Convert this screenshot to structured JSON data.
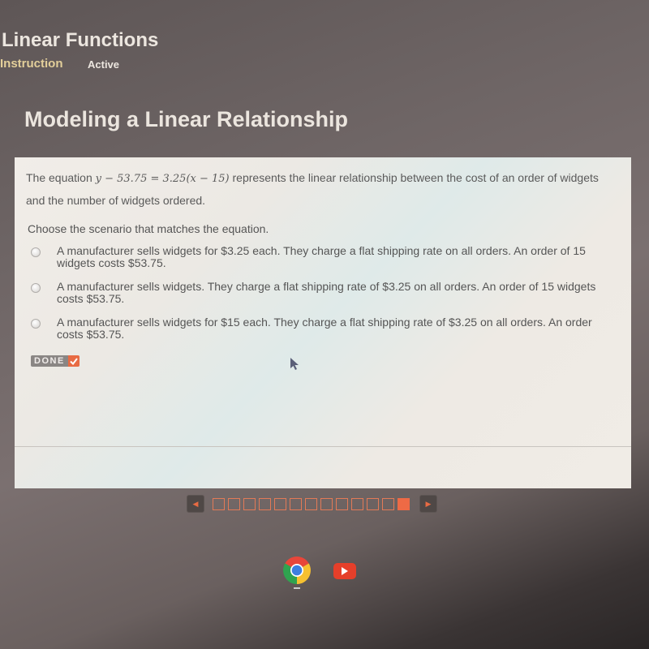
{
  "header": {
    "title": "Linear Functions",
    "tabs": [
      {
        "label": "Instruction"
      },
      {
        "label": "Active"
      }
    ]
  },
  "lesson": {
    "title": "Modeling a Linear Relationship"
  },
  "question": {
    "prompt_prefix": "The equation ",
    "equation": "y − 53.75 = 3.25(x − 15)",
    "prompt_suffix": " represents the linear relationship between the cost of an order of widgets and the number of widgets ordered.",
    "instruction": "Choose the scenario that matches the equation.",
    "options": [
      {
        "text": "A manufacturer sells widgets for $3.25 each. They charge a flat shipping rate on all orders. An order of 15 widgets costs $53.75.",
        "selected": false
      },
      {
        "text": "A manufacturer sells widgets. They charge a flat shipping rate of $3.25 on all orders. An order of 15 widgets costs $53.75.",
        "selected": false
      },
      {
        "text": "A manufacturer sells widgets for $15 each. They charge a flat shipping rate of $3.25 on all orders. An order costs $53.75.",
        "selected": false
      }
    ],
    "done_label": "DONE"
  },
  "pager": {
    "total_pages": 13,
    "current_page": 13,
    "prev_icon": "triangle-left",
    "next_icon": "triangle-right"
  },
  "shelf": {
    "apps": [
      "chrome-icon",
      "youtube-icon"
    ]
  },
  "colors": {
    "accent": "#e86b43",
    "tab_instruction": "#e3cf9a"
  }
}
